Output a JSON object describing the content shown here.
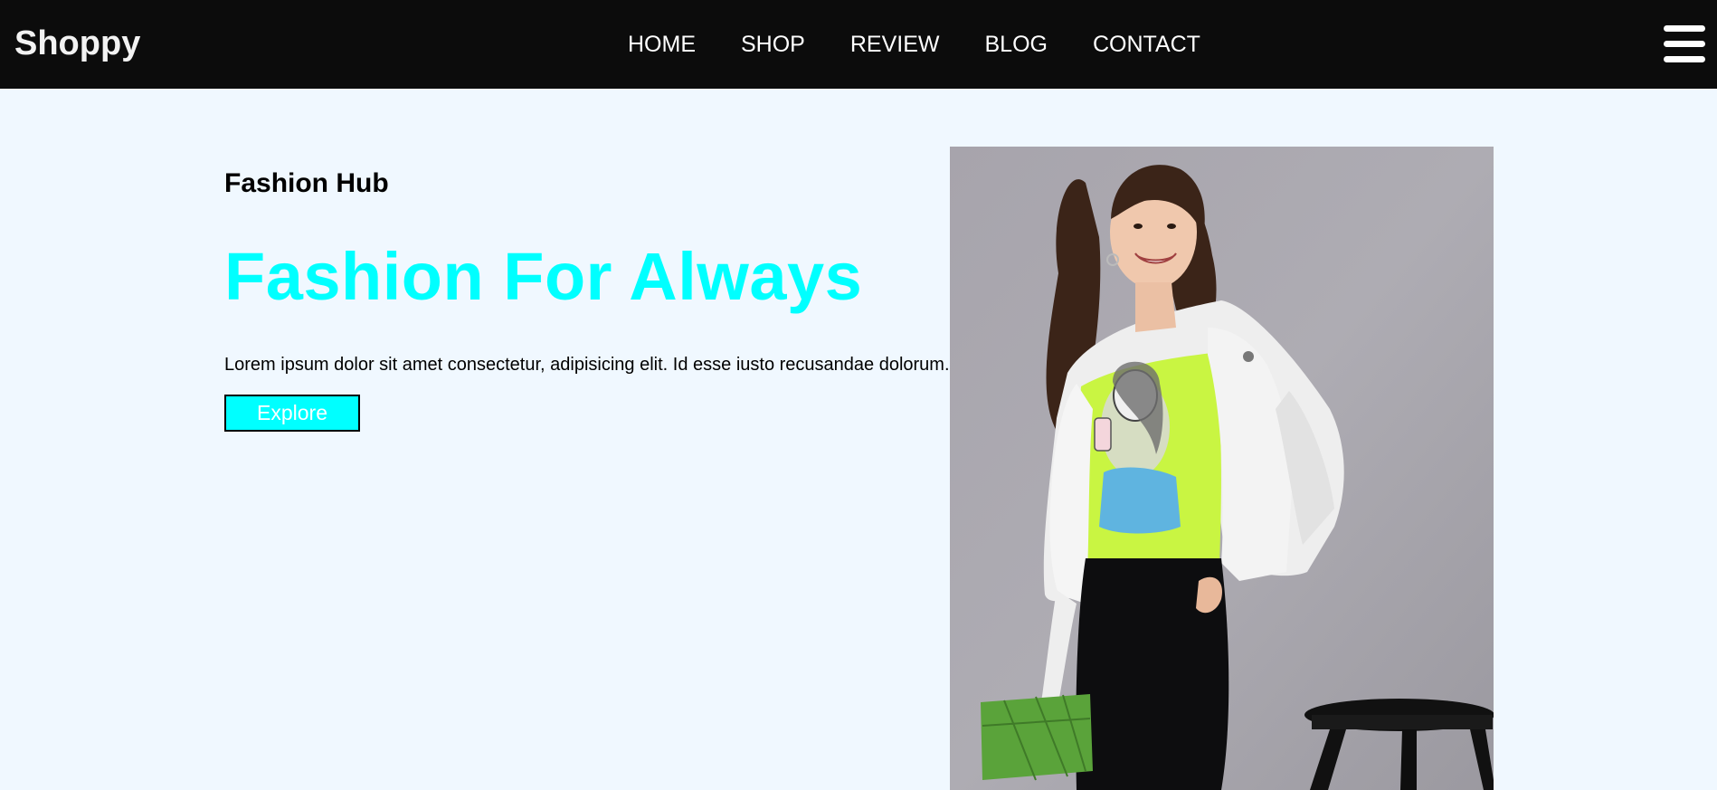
{
  "navbar": {
    "brand": "Shoppy",
    "links": [
      {
        "label": "HOME"
      },
      {
        "label": "SHOP"
      },
      {
        "label": "REVIEW"
      },
      {
        "label": "BLOG"
      },
      {
        "label": "CONTACT"
      }
    ],
    "menu_icon": "hamburger-menu-icon"
  },
  "hero": {
    "subtitle": "Fashion Hub",
    "headline": "Fashion For Always",
    "description": "Lorem ipsum dolor sit amet consectetur, adipisicing elit. Id esse iusto recusandae dolorum.",
    "button_label": "Explore",
    "image": "model-photo-woman-in-lime-tshirt-and-white-jacket"
  },
  "colors": {
    "navbar_bg": "#0c0c0c",
    "page_bg": "#f0f8ff",
    "accent": "#00ffff",
    "nav_text": "#ffffff"
  }
}
